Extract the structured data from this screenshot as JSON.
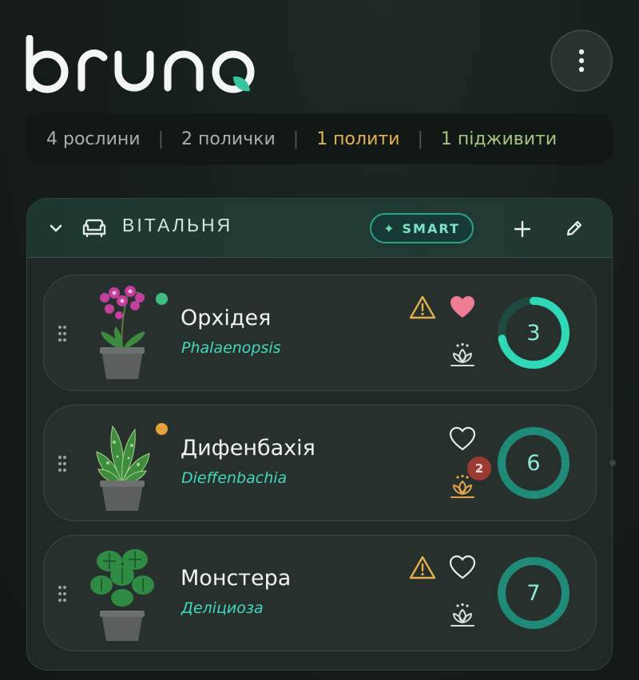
{
  "app": {
    "logo_text": "bruno"
  },
  "stats": {
    "plants": "4 рослини",
    "shelves": "2 полички",
    "water": "1 полити",
    "feed": "1 підживити",
    "separator": "|"
  },
  "room": {
    "title": "ВІТАЛЬНЯ",
    "smart_label": "SMART",
    "smart_icon": "sparkle-icon",
    "plants": [
      {
        "name": "Орхідея",
        "latin": "Phalaenopsis",
        "status_color": "#3fbf7f",
        "warning": true,
        "favorite": true,
        "feed_badge": "",
        "days": "3",
        "progress": 0.72
      },
      {
        "name": "Дифенбахія",
        "latin": "Dieffenbachia",
        "status_color": "#e5a23a",
        "warning": false,
        "favorite": false,
        "feed_badge": "2",
        "days": "6",
        "progress": 1.0
      },
      {
        "name": "Монстера",
        "latin": "Деліциоза",
        "status_color": "",
        "warning": true,
        "favorite": false,
        "feed_badge": "",
        "days": "7",
        "progress": 1.0
      }
    ]
  },
  "colors": {
    "accent": "#2fd9b8",
    "warning": "#e4b04a",
    "heart": "#ef7d96",
    "badge": "#9c3b33"
  }
}
